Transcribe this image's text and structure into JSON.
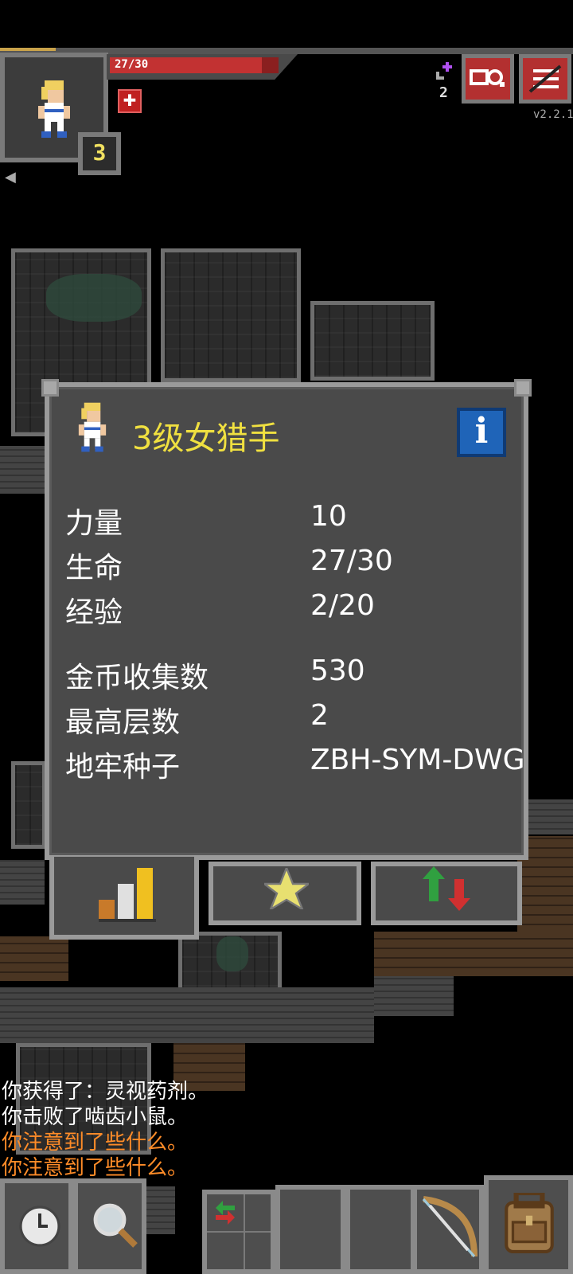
{
  "hud": {
    "hp_text": "27/30",
    "hp_current": 27,
    "hp_max": 30,
    "level": "3",
    "keys_count": "2",
    "version": "v2.2.1",
    "buff_icon": "health-buff-icon",
    "search_journal_icon": "journal-icon",
    "menu_icon": "menu-icon"
  },
  "dialog": {
    "title": "3级女猎手",
    "info_icon": "i",
    "stats": [
      {
        "label": "力量",
        "value": "10"
      },
      {
        "label": "生命",
        "value": "27/30"
      },
      {
        "label": "经验",
        "value": "2/20"
      },
      {
        "label": "金币收集数",
        "value": "530"
      },
      {
        "label": "最高层数",
        "value": "2"
      },
      {
        "label": "地牢种子",
        "value": "ZBH-SYM-DWG"
      }
    ],
    "tabs": [
      "stats-tab-icon",
      "badges-tab-icon",
      "challenges-tab-icon"
    ]
  },
  "log": [
    {
      "text": "你获得了：灵视药剂。",
      "color": "#ffffff"
    },
    {
      "text": "你击败了啮齿小鼠。",
      "color": "#ffffff"
    },
    {
      "text": "你注意到了些什么。",
      "color": "#ff8c28"
    },
    {
      "text": "你注意到了些什么。",
      "color": "#ff8c28"
    }
  ],
  "toolbar": {
    "wait_icon": "clock-icon",
    "search_icon": "magnifier-icon",
    "swap_icon": "swap-icon",
    "quickslot_item_icon": "bow-icon",
    "inventory_icon": "backpack-icon"
  }
}
